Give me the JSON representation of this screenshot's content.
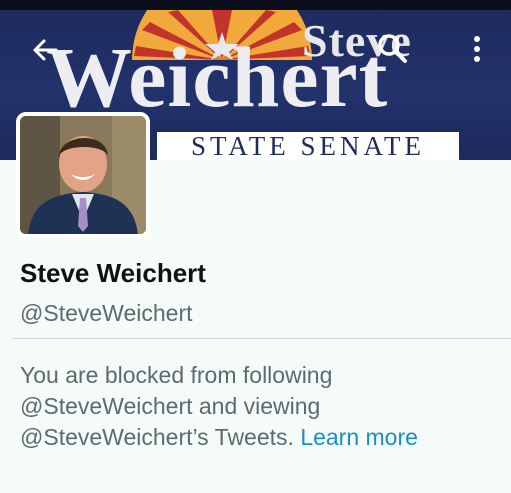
{
  "banner": {
    "first_name": "Steve",
    "last_name": "Weichert",
    "subtitle": "STATE SENATE",
    "background_color": "#1d2b5e",
    "sun_colors": [
      "#c2342b",
      "#f2a93b"
    ]
  },
  "toolbar": {
    "back_icon": "arrow-left-icon",
    "search_icon": "search-icon",
    "menu_icon": "more-vertical-icon"
  },
  "profile": {
    "name": "Steve Weichert",
    "handle": "@SteveWeichert",
    "avatar_icon": "avatar-photo"
  },
  "notice": {
    "text": "You are blocked from following @SteveWeichert and viewing @SteveWeichert’s Tweets. ",
    "link_text": "Learn more",
    "link_color": "#1b8fc4"
  }
}
